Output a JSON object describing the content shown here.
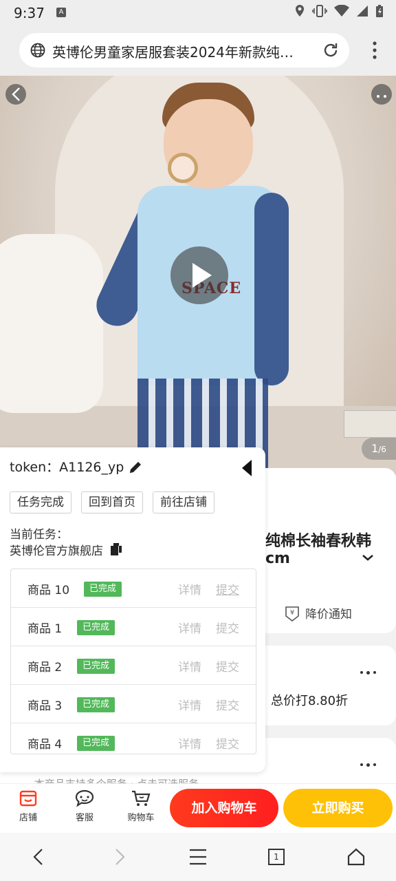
{
  "status_bar": {
    "time": "9:37",
    "app_icon_letter": "A"
  },
  "browser": {
    "url_text": "英博伦男童家居服套装2024年新款纯…"
  },
  "hero": {
    "image_counter_current": "1",
    "image_counter_total": "/6",
    "shirt_print": "SPACE"
  },
  "product": {
    "title_line1": "纯棉长袖春秋韩",
    "title_line2": "cm",
    "price_alert": "降价通知",
    "discount_text": "总价打8.80折",
    "faded_text": "… 本商品支持多个服务 · 点击可选服务 …"
  },
  "panel": {
    "token_label": "token：",
    "token_value": "A1126_yp",
    "buttons": [
      "任务完成",
      "回到首页",
      "前往店铺"
    ],
    "current_task_label": "当前任务：",
    "current_task_value": "英博伦官方旗舰店",
    "rows": [
      {
        "name": "商品 10",
        "status": "已完成",
        "detail": "详情",
        "submit": "提交"
      },
      {
        "name": "商品 1",
        "status": "已完成",
        "detail": "详情",
        "submit": "提交"
      },
      {
        "name": "商品 2",
        "status": "已完成",
        "detail": "详情",
        "submit": "提交"
      },
      {
        "name": "商品 3",
        "status": "已完成",
        "detail": "详情",
        "submit": "提交"
      },
      {
        "name": "商品 4",
        "status": "已完成",
        "detail": "详情",
        "submit": "提交"
      }
    ]
  },
  "action_bar": {
    "shop_label": "店铺",
    "service_label": "客服",
    "cart_label": "购物车",
    "add_to_cart": "加入购物车",
    "buy_now": "立即购买"
  },
  "nav_bar": {
    "tab_count": "1"
  },
  "colors": {
    "accent_red": "#ff2a1e",
    "accent_yellow": "#ffc107",
    "badge_green": "#52b85a"
  }
}
